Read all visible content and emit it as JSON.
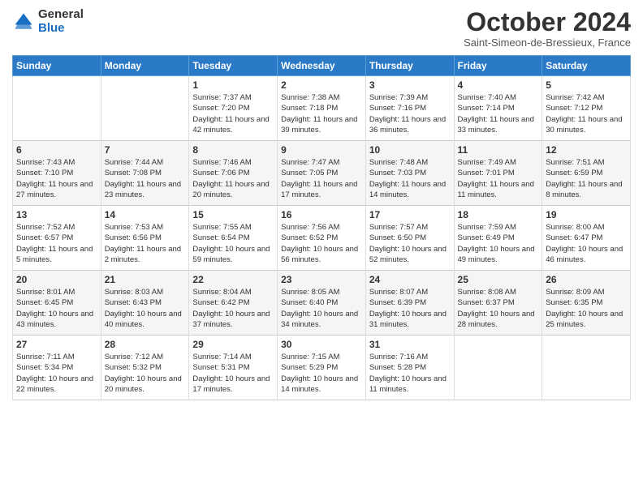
{
  "header": {
    "logo_general": "General",
    "logo_blue": "Blue",
    "month": "October 2024",
    "location": "Saint-Simeon-de-Bressieux, France"
  },
  "days_of_week": [
    "Sunday",
    "Monday",
    "Tuesday",
    "Wednesday",
    "Thursday",
    "Friday",
    "Saturday"
  ],
  "weeks": [
    [
      {
        "day": "",
        "content": ""
      },
      {
        "day": "",
        "content": ""
      },
      {
        "day": "1",
        "content": "Sunrise: 7:37 AM\nSunset: 7:20 PM\nDaylight: 11 hours and 42 minutes."
      },
      {
        "day": "2",
        "content": "Sunrise: 7:38 AM\nSunset: 7:18 PM\nDaylight: 11 hours and 39 minutes."
      },
      {
        "day": "3",
        "content": "Sunrise: 7:39 AM\nSunset: 7:16 PM\nDaylight: 11 hours and 36 minutes."
      },
      {
        "day": "4",
        "content": "Sunrise: 7:40 AM\nSunset: 7:14 PM\nDaylight: 11 hours and 33 minutes."
      },
      {
        "day": "5",
        "content": "Sunrise: 7:42 AM\nSunset: 7:12 PM\nDaylight: 11 hours and 30 minutes."
      }
    ],
    [
      {
        "day": "6",
        "content": "Sunrise: 7:43 AM\nSunset: 7:10 PM\nDaylight: 11 hours and 27 minutes."
      },
      {
        "day": "7",
        "content": "Sunrise: 7:44 AM\nSunset: 7:08 PM\nDaylight: 11 hours and 23 minutes."
      },
      {
        "day": "8",
        "content": "Sunrise: 7:46 AM\nSunset: 7:06 PM\nDaylight: 11 hours and 20 minutes."
      },
      {
        "day": "9",
        "content": "Sunrise: 7:47 AM\nSunset: 7:05 PM\nDaylight: 11 hours and 17 minutes."
      },
      {
        "day": "10",
        "content": "Sunrise: 7:48 AM\nSunset: 7:03 PM\nDaylight: 11 hours and 14 minutes."
      },
      {
        "day": "11",
        "content": "Sunrise: 7:49 AM\nSunset: 7:01 PM\nDaylight: 11 hours and 11 minutes."
      },
      {
        "day": "12",
        "content": "Sunrise: 7:51 AM\nSunset: 6:59 PM\nDaylight: 11 hours and 8 minutes."
      }
    ],
    [
      {
        "day": "13",
        "content": "Sunrise: 7:52 AM\nSunset: 6:57 PM\nDaylight: 11 hours and 5 minutes."
      },
      {
        "day": "14",
        "content": "Sunrise: 7:53 AM\nSunset: 6:56 PM\nDaylight: 11 hours and 2 minutes."
      },
      {
        "day": "15",
        "content": "Sunrise: 7:55 AM\nSunset: 6:54 PM\nDaylight: 10 hours and 59 minutes."
      },
      {
        "day": "16",
        "content": "Sunrise: 7:56 AM\nSunset: 6:52 PM\nDaylight: 10 hours and 56 minutes."
      },
      {
        "day": "17",
        "content": "Sunrise: 7:57 AM\nSunset: 6:50 PM\nDaylight: 10 hours and 52 minutes."
      },
      {
        "day": "18",
        "content": "Sunrise: 7:59 AM\nSunset: 6:49 PM\nDaylight: 10 hours and 49 minutes."
      },
      {
        "day": "19",
        "content": "Sunrise: 8:00 AM\nSunset: 6:47 PM\nDaylight: 10 hours and 46 minutes."
      }
    ],
    [
      {
        "day": "20",
        "content": "Sunrise: 8:01 AM\nSunset: 6:45 PM\nDaylight: 10 hours and 43 minutes."
      },
      {
        "day": "21",
        "content": "Sunrise: 8:03 AM\nSunset: 6:43 PM\nDaylight: 10 hours and 40 minutes."
      },
      {
        "day": "22",
        "content": "Sunrise: 8:04 AM\nSunset: 6:42 PM\nDaylight: 10 hours and 37 minutes."
      },
      {
        "day": "23",
        "content": "Sunrise: 8:05 AM\nSunset: 6:40 PM\nDaylight: 10 hours and 34 minutes."
      },
      {
        "day": "24",
        "content": "Sunrise: 8:07 AM\nSunset: 6:39 PM\nDaylight: 10 hours and 31 minutes."
      },
      {
        "day": "25",
        "content": "Sunrise: 8:08 AM\nSunset: 6:37 PM\nDaylight: 10 hours and 28 minutes."
      },
      {
        "day": "26",
        "content": "Sunrise: 8:09 AM\nSunset: 6:35 PM\nDaylight: 10 hours and 25 minutes."
      }
    ],
    [
      {
        "day": "27",
        "content": "Sunrise: 7:11 AM\nSunset: 5:34 PM\nDaylight: 10 hours and 22 minutes."
      },
      {
        "day": "28",
        "content": "Sunrise: 7:12 AM\nSunset: 5:32 PM\nDaylight: 10 hours and 20 minutes."
      },
      {
        "day": "29",
        "content": "Sunrise: 7:14 AM\nSunset: 5:31 PM\nDaylight: 10 hours and 17 minutes."
      },
      {
        "day": "30",
        "content": "Sunrise: 7:15 AM\nSunset: 5:29 PM\nDaylight: 10 hours and 14 minutes."
      },
      {
        "day": "31",
        "content": "Sunrise: 7:16 AM\nSunset: 5:28 PM\nDaylight: 10 hours and 11 minutes."
      },
      {
        "day": "",
        "content": ""
      },
      {
        "day": "",
        "content": ""
      }
    ]
  ]
}
